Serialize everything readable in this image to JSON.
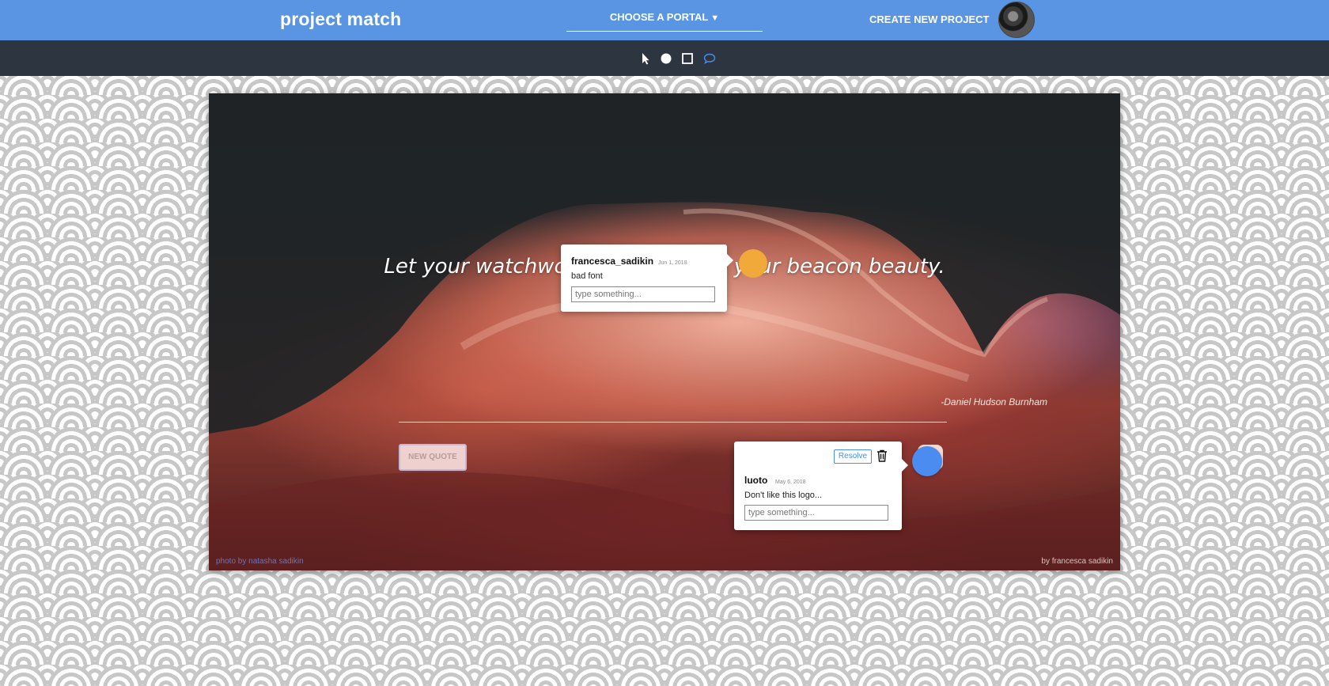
{
  "header": {
    "brand": "project match",
    "portal_label": "CHOOSE A PORTAL",
    "portal_caret": "▼",
    "create_label": "CREATE NEW PROJECT"
  },
  "toolbar": {
    "tools": [
      "pointer-icon",
      "circle-icon",
      "square-icon",
      "comment-icon"
    ],
    "active_tool": "comment-icon",
    "active_color": "#4a8cf0"
  },
  "canvas": {
    "quote": "Let your watchword be order and your beacon beauty.",
    "author": "-Daniel Hudson Burnham",
    "new_quote_label": "NEW QUOTE",
    "credit_left": "photo by natasha sadikin",
    "credit_right": "by francesca sadikin"
  },
  "comments": [
    {
      "user": "francesca_sadikin",
      "date": "Jun 1, 2018",
      "text": "bad font",
      "placeholder": "type something...",
      "pin_color": "#f1a93a"
    },
    {
      "user": "luoto",
      "date": "May 6, 2018",
      "text": "Don't like this logo...",
      "placeholder": "type something...",
      "resolve_label": "Resolve",
      "pin_color": "#4a8cf0"
    }
  ],
  "colors": {
    "header_bg": "#5995e3",
    "toolbar_bg": "#2d3540"
  }
}
